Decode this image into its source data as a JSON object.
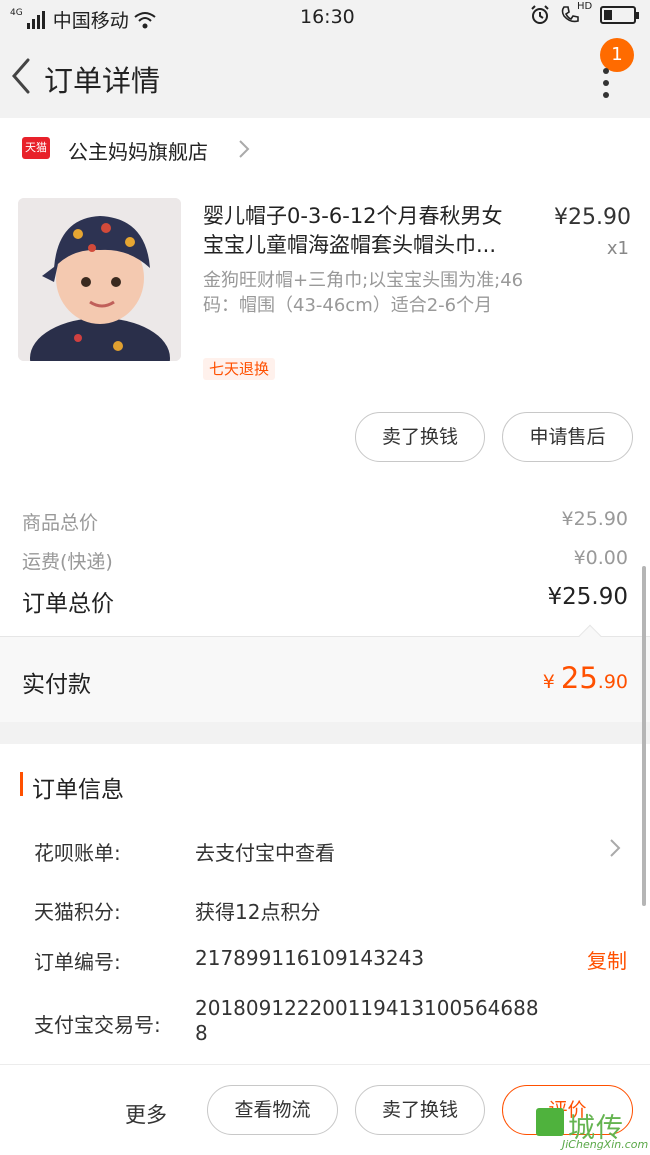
{
  "status_bar": {
    "network_type": "4G",
    "carrier": "中国移动",
    "time": "16:30",
    "hd_label": "HD",
    "battery_level_percent": 30,
    "icons": [
      "signal-icon",
      "wifi-icon",
      "alarm-icon",
      "call-hd-icon",
      "battery-icon"
    ]
  },
  "header": {
    "title": "订单详情",
    "notification_count": "1",
    "icons": [
      "back-arrow-icon",
      "more-vertical-icon"
    ]
  },
  "shop": {
    "platform_logo_text": "天猫",
    "name": "公主妈妈旗舰店"
  },
  "product": {
    "title_line1": "婴儿帽子0-3-6-12个月春秋男女",
    "title_line2": "宝宝儿童帽海盗帽套头帽头巾...",
    "price": "¥25.90",
    "quantity": "x1",
    "sku": "金狗旺财帽+三角巾;以宝宝头围为准;46码：帽围（43-46cm）适合2-6个月",
    "tag": "七天退换",
    "actions": [
      "卖了换钱",
      "申请售后"
    ]
  },
  "summary": {
    "goods_total_label": "商品总价",
    "goods_total": "¥25.90",
    "shipping_label": "运费(快递)",
    "shipping": "¥0.00",
    "order_total_label": "订单总价",
    "order_total": "¥25.90",
    "paid_label": "实付款",
    "paid_currency": "¥",
    "paid_integer": "25",
    "paid_decimal": ".90"
  },
  "order_info": {
    "section_title": "订单信息",
    "rows": [
      {
        "label": "花呗账单:",
        "value": "去支付宝中查看"
      },
      {
        "label": "天猫积分:",
        "value": "获得12点积分"
      },
      {
        "label": "订单编号:",
        "value": "217899116109143243"
      },
      {
        "label": "支付宝交易号:",
        "value": "2018091222001194131005646888"
      }
    ],
    "copy_label": "复制"
  },
  "bottom_bar": {
    "more": "更多",
    "buttons": [
      "查看物流",
      "卖了换钱",
      "评价"
    ]
  },
  "watermark": {
    "cn": "城传",
    "en": "JiChengXin.com"
  },
  "colors": {
    "accent": "#ff5000",
    "badge": "#ff6b00",
    "tmall_red": "#e8212a",
    "page_bg": "#f2f2f2"
  }
}
